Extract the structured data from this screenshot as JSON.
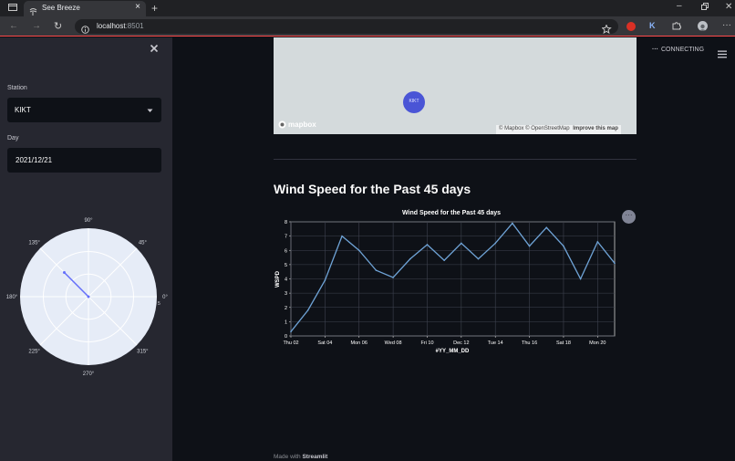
{
  "browser": {
    "tab_title": "See Breeze",
    "url_host": "localhost",
    "url_port": ":8501",
    "profile_badge": "K"
  },
  "app": {
    "status": "CONNECTING"
  },
  "sidebar": {
    "station_label": "Station",
    "station_value": "KIKT",
    "day_label": "Day",
    "day_value": "2021/12/21",
    "polar": {
      "angle_labels": [
        "90°",
        "45°",
        "0°",
        "315°",
        "270°",
        "225°",
        "180°",
        "135°"
      ],
      "radial_tick": "5",
      "direction_deg": 135,
      "magnitude": 0.5
    }
  },
  "map": {
    "marker_label": "KIKT",
    "logo": "mapbox",
    "attribution": "© Mapbox © OpenStreetMap",
    "improve_link": "Improve this map"
  },
  "section": {
    "heading": "Wind Speed for the Past 45 days"
  },
  "footer": {
    "prefix": "Made with ",
    "brand": "Streamlit"
  },
  "chart_data": {
    "type": "line",
    "title": "Wind Speed for the Past 45 days",
    "xlabel": "#YY_MM_DD",
    "ylabel": "WSPD",
    "x_tick_labels": [
      "Thu 02",
      "Sat 04",
      "Mon 06",
      "Wed 08",
      "Fri 10",
      "Dec 12",
      "Tue 14",
      "Thu 16",
      "Sat 18",
      "Mon 20"
    ],
    "ylim": [
      0,
      8
    ],
    "y_ticks": [
      0,
      1,
      2,
      3,
      4,
      5,
      6,
      7,
      8
    ],
    "grid": true,
    "line_color": "#6fa3d6",
    "series": [
      {
        "x": [
          2,
          3,
          4,
          5,
          6,
          7,
          8,
          9,
          10,
          11,
          12,
          13,
          14,
          15,
          16,
          17,
          18,
          19,
          20,
          21
        ],
        "values": [
          0.3,
          1.8,
          3.9,
          7.0,
          6.0,
          4.6,
          4.1,
          5.4,
          6.4,
          5.3,
          6.5,
          5.4,
          6.5,
          7.9,
          6.3,
          7.6,
          6.3,
          4.0,
          6.6,
          5.1
        ]
      }
    ]
  }
}
